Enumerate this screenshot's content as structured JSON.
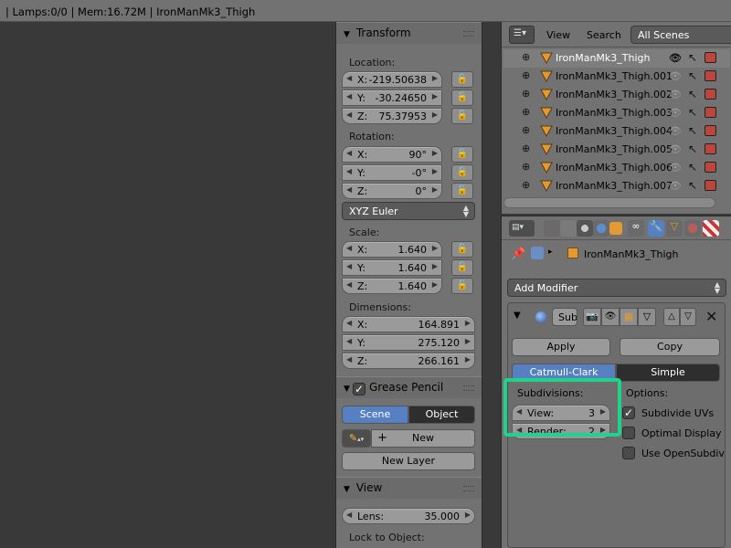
{
  "statusbar": {
    "text": "| Lamps:0/0 | Mem:16.72M | IronManMk3_Thigh"
  },
  "transform": {
    "title": "Transform",
    "location_label": "Location:",
    "location": [
      {
        "k": "X:",
        "v": "-219.50638"
      },
      {
        "k": "Y:",
        "v": "-30.24650"
      },
      {
        "k": "Z:",
        "v": "75.37953"
      }
    ],
    "rotation_label": "Rotation:",
    "rotation": [
      {
        "k": "X:",
        "v": "90°"
      },
      {
        "k": "Y:",
        "v": "-0°"
      },
      {
        "k": "Z:",
        "v": "0°"
      }
    ],
    "rotation_mode": "XYZ Euler",
    "scale_label": "Scale:",
    "scale": [
      {
        "k": "X:",
        "v": "1.640"
      },
      {
        "k": "Y:",
        "v": "1.640"
      },
      {
        "k": "Z:",
        "v": "1.640"
      }
    ],
    "dimensions_label": "Dimensions:",
    "dimensions": [
      {
        "k": "X:",
        "v": "164.891"
      },
      {
        "k": "Y:",
        "v": "275.120"
      },
      {
        "k": "Z:",
        "v": "266.161"
      }
    ]
  },
  "grease_pencil": {
    "title": "Grease Pencil",
    "scene_tab": "Scene",
    "object_tab": "Object",
    "new_label": "New",
    "new_layer_label": "New Layer"
  },
  "view_panel": {
    "title": "View",
    "lens_label": "Lens:",
    "lens_value": "35.000",
    "lock_label": "Lock to Object:"
  },
  "outliner": {
    "menu_view": "View",
    "menu_search": "Search",
    "scene_select": "All Scenes",
    "items": [
      "IronManMk3_Thigh",
      "IronManMk3_Thigh.001",
      "IronManMk3_Thigh.002",
      "IronManMk3_Thigh.003",
      "IronManMk3_Thigh.004",
      "IronManMk3_Thigh.005",
      "IronManMk3_Thigh.006",
      "IronManMk3_Thigh.007"
    ]
  },
  "properties": {
    "object_name": "IronManMk3_Thigh",
    "add_modifier": "Add Modifier",
    "modifier_name": "Sub",
    "apply_label": "Apply",
    "copy_label": "Copy",
    "tab_catmull": "Catmull-Clark",
    "tab_simple": "Simple",
    "subdivisions_label": "Subdivisions:",
    "view_label": "View:",
    "view_value": "3",
    "render_label": "Render:",
    "render_value": "2",
    "options_label": "Options:",
    "opt_subdivide_uvs": "Subdivide UVs",
    "opt_optimal_display": "Optimal Display",
    "opt_opensubdiv": "Use OpenSubdiv"
  },
  "colors": {
    "highlight": "#1fd38d",
    "active_tab": "#5680c2",
    "panel_bg": "#727272"
  }
}
